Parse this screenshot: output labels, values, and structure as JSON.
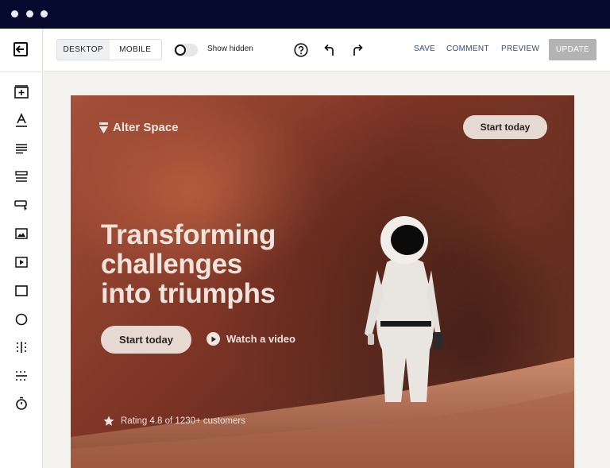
{
  "window": {
    "dots": 3
  },
  "toolbar": {
    "device_desktop": "DESKTOP",
    "device_mobile": "MOBILE",
    "show_hidden_label": "Show hidden",
    "save_label": "SAVE",
    "comment_label": "COMMENT",
    "preview_label": "PREVIEW",
    "update_label": "UPDATE"
  },
  "sidebar": {
    "icons": [
      "exit-icon",
      "add-section-icon",
      "text-icon",
      "paragraph-icon",
      "list-icon",
      "button-icon",
      "image-icon",
      "video-icon",
      "rectangle-icon",
      "circle-icon",
      "columns-icon",
      "divider-icon",
      "timer-icon"
    ]
  },
  "hero": {
    "brand": "Alter Space",
    "nav_cta": "Start today",
    "headline_1": "Transforming",
    "headline_2": "challenges",
    "headline_3": "into triumphs",
    "cta": "Start today",
    "video_link": "Watch a video",
    "rating": "Rating 4.8 of 1230+ customers"
  },
  "colors": {
    "titlebar": "#050a2e",
    "link": "#3a4a88",
    "update_bg": "#b3b3b3",
    "cta_bg": "#e6d9d1"
  }
}
